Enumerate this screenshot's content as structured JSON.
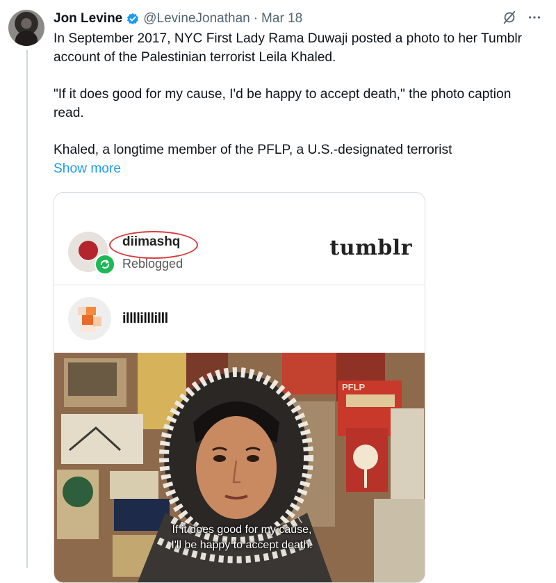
{
  "tweet": {
    "author_name": "Jon Levine",
    "handle": "@LevineJonathan",
    "separator": "·",
    "date": "Mar 18",
    "paragraphs": [
      "In September 2017, NYC First Lady Rama Duwaji posted a photo to her Tumblr account of the Palestinian terrorist Leila Khaled.",
      "\"If it does good for my cause, I'd be happy to accept death,\" the photo caption read.",
      "Khaled, a longtime member of the PFLP, a U.S.-designated terrorist"
    ],
    "show_more": "Show more",
    "icons": {
      "verified": "verified-badge-icon",
      "grok": "grok-icon",
      "more": "more-options-icon"
    },
    "colors": {
      "link": "#1d9bf0",
      "verified": "#1d9bf0",
      "secondary": "#536471"
    }
  },
  "card": {
    "username": "diimashq",
    "reblog_status": "Reblogged",
    "platform": "tumblr",
    "original_poster": "illllilllilll",
    "photo_caption_line1": "If it does good for my cause,",
    "photo_caption_line2": "I'll be happy to accept death.",
    "poster_text": "PFLP",
    "highlight_color": "#d83b3b"
  }
}
